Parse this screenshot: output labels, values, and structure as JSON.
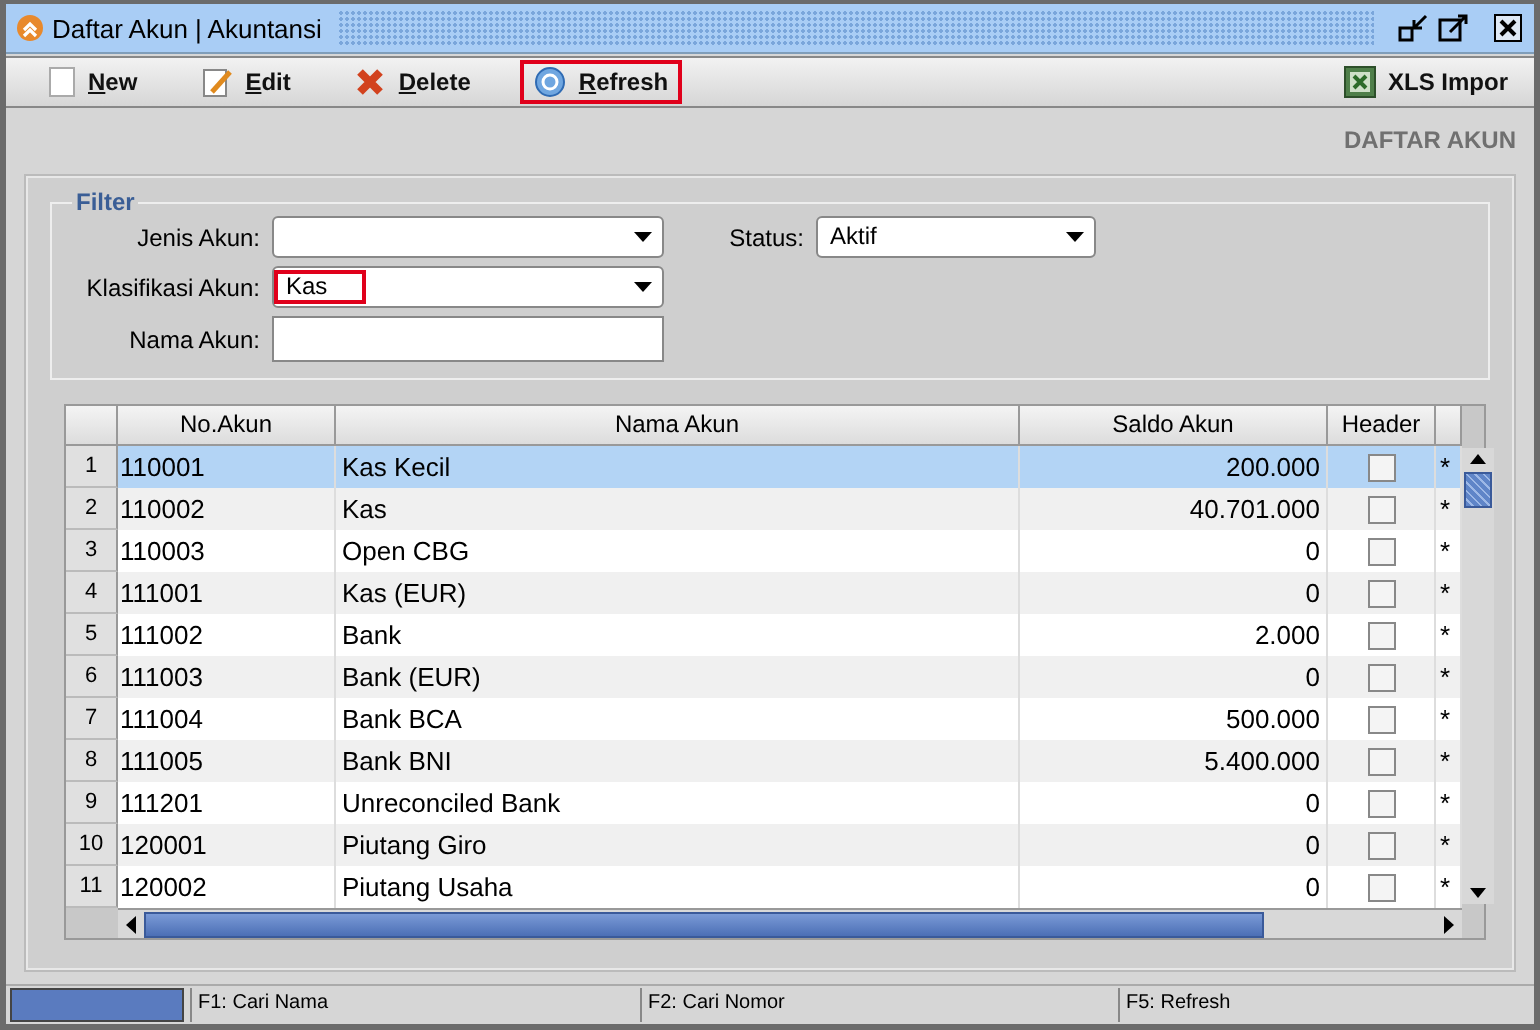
{
  "window": {
    "title": "Daftar Akun | Akuntansi"
  },
  "toolbar": [
    {
      "label": "New",
      "highlighted": false
    },
    {
      "label": "Edit",
      "highlighted": false
    },
    {
      "label": "Delete",
      "highlighted": false
    },
    {
      "label": "Refresh",
      "highlighted": true
    }
  ],
  "import_button": {
    "label": "XLS Impor"
  },
  "page_title": "DAFTAR AKUN",
  "filter": {
    "legend": "Filter",
    "fields": [
      {
        "label": "Jenis Akun:",
        "kind": "dropdown",
        "highlighted": false
      },
      {
        "label": "Klasifikasi Akun:",
        "kind": "dropdown",
        "value": "Kas",
        "highlighted": true
      },
      {
        "label": "Nama Akun:",
        "kind": "text",
        "highlighted": false
      }
    ],
    "status": {
      "label": "Status:",
      "value": "Aktif"
    }
  },
  "table": {
    "columns": [
      "No.Akun",
      "Nama Akun",
      "Saldo Akun",
      "Header"
    ],
    "rows": [
      {
        "index": "1",
        "no": "110001",
        "name": "Kas Kecil",
        "saldo": "200.000",
        "header": false,
        "mark": "*",
        "selected": true
      },
      {
        "index": "2",
        "no": "110002",
        "name": "Kas",
        "saldo": "40.701.000",
        "header": false,
        "mark": "*",
        "selected": false
      },
      {
        "index": "3",
        "no": "110003",
        "name": "Open CBG",
        "saldo": "0",
        "header": false,
        "mark": "*",
        "selected": false
      },
      {
        "index": "4",
        "no": "111001",
        "name": "Kas (EUR)",
        "saldo": "0",
        "header": false,
        "mark": "*",
        "selected": false
      },
      {
        "index": "5",
        "no": "111002",
        "name": "Bank",
        "saldo": "2.000",
        "header": false,
        "mark": "*",
        "selected": false
      },
      {
        "index": "6",
        "no": "111003",
        "name": "Bank (EUR)",
        "saldo": "0",
        "header": false,
        "mark": "*",
        "selected": false
      },
      {
        "index": "7",
        "no": "111004",
        "name": "Bank BCA",
        "saldo": "500.000",
        "header": false,
        "mark": "*",
        "selected": false
      },
      {
        "index": "8",
        "no": "111005",
        "name": "Bank BNI",
        "saldo": "5.400.000",
        "header": false,
        "mark": "*",
        "selected": false
      },
      {
        "index": "9",
        "no": "111201",
        "name": "Unreconciled Bank",
        "saldo": "0",
        "header": false,
        "mark": "*",
        "selected": false
      },
      {
        "index": "10",
        "no": "120001",
        "name": "Piutang Giro",
        "saldo": "0",
        "header": false,
        "mark": "*",
        "selected": false
      },
      {
        "index": "11",
        "no": "120002",
        "name": "Piutang Usaha",
        "saldo": "0",
        "header": false,
        "mark": "*",
        "selected": false
      }
    ]
  },
  "status_bar": [
    "F1: Cari Nama",
    "F2: Cari Nomor",
    "F5: Refresh"
  ]
}
